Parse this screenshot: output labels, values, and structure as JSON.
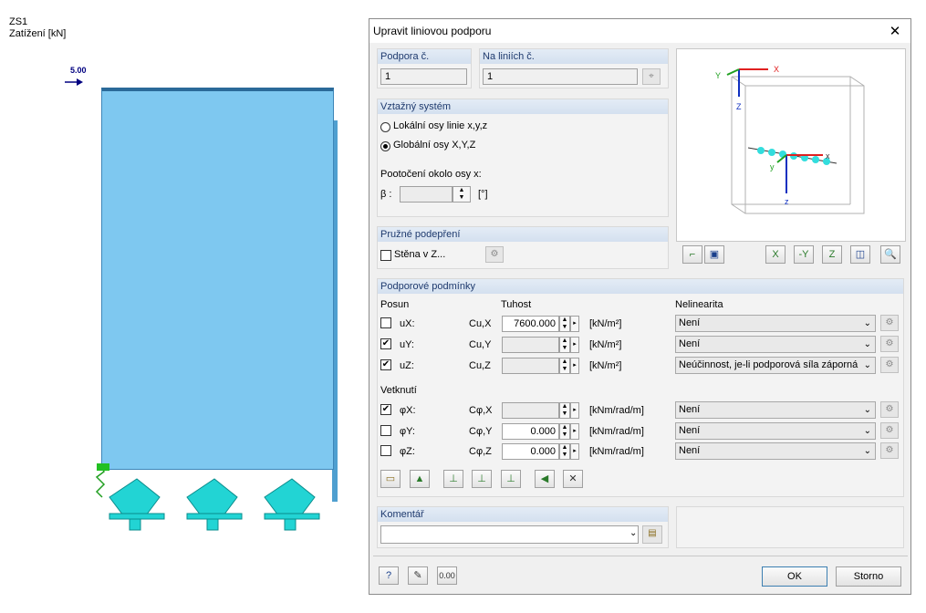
{
  "viewport": {
    "case": "ZS1",
    "load_label": "Zatížení [kN]",
    "load_value": "5.00"
  },
  "dialog": {
    "title": "Upravit liniovou podporu",
    "support_no": {
      "label": "Podpora č.",
      "value": "1"
    },
    "on_lines": {
      "label": "Na liniích č.",
      "value": "1"
    },
    "ref_system": {
      "header": "Vztažný systém",
      "local": "Lokální osy linie x,y,z",
      "global": "Globální osy X,Y,Z",
      "rotation_label": "Pootočení okolo osy x:",
      "beta_label": "β :",
      "beta_unit": "[°]"
    },
    "elastic": {
      "header": "Pružné podepření",
      "wall": "Stěna v Z..."
    },
    "preview": {
      "axis_x": "X",
      "axis_y": "Y",
      "axis_z": "Z",
      "local_x": "x",
      "local_y": "y",
      "local_z": "z"
    },
    "conditions": {
      "header": "Podporové podmínky",
      "col_posun": "Posun",
      "col_tuhost": "Tuhost",
      "col_nelin": "Nelinearita",
      "vetknuti": "Vetknutí",
      "rows": [
        {
          "label": "uX:",
          "sym": "Cu,X",
          "checked": false,
          "value": "7600.000",
          "unit": "[kN/m²]",
          "nonlin": "Není"
        },
        {
          "label": "uY:",
          "sym": "Cu,Y",
          "checked": true,
          "value": "",
          "unit": "[kN/m²]",
          "nonlin": "Není"
        },
        {
          "label": "uZ:",
          "sym": "Cu,Z",
          "checked": true,
          "value": "",
          "unit": "[kN/m²]",
          "nonlin": "Neúčinnost, je-li podporová síla záporná"
        },
        {
          "label": "φX:",
          "sym": "Cφ,X",
          "checked": true,
          "value": "",
          "unit": "[kNm/rad/m]",
          "nonlin": "Není"
        },
        {
          "label": "φY:",
          "sym": "Cφ,Y",
          "checked": false,
          "value": "0.000",
          "unit": "[kNm/rad/m]",
          "nonlin": "Není"
        },
        {
          "label": "φZ:",
          "sym": "Cφ,Z",
          "checked": false,
          "value": "0.000",
          "unit": "[kNm/rad/m]",
          "nonlin": "Není"
        }
      ]
    },
    "comment": {
      "header": "Komentář",
      "value": ""
    },
    "ok": "OK",
    "cancel": "Storno"
  }
}
